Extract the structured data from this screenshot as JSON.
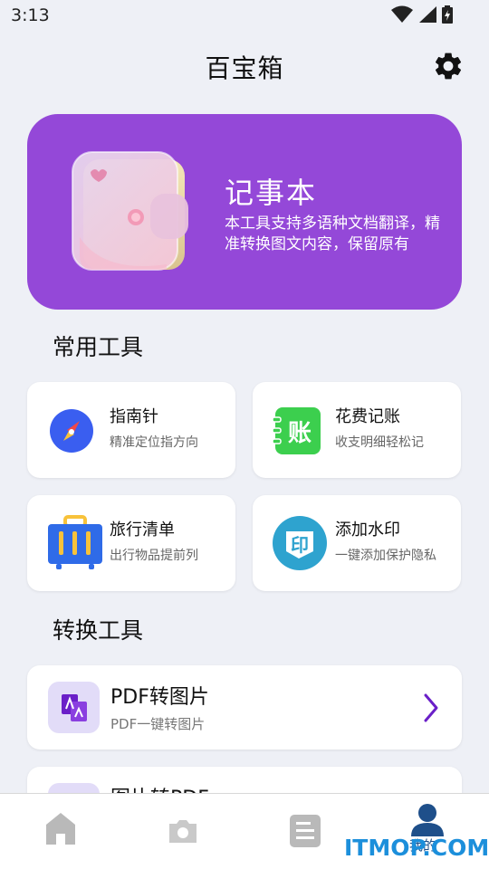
{
  "status_bar": {
    "time": "3:13",
    "icons": [
      "wifi-icon",
      "signal-icon",
      "battery-charging-icon"
    ]
  },
  "header": {
    "title": "百宝箱",
    "settings_icon": "gear-icon"
  },
  "banner": {
    "title": "记事本",
    "description": "本工具支持多语种文档翻译，精准转换图文内容，保留原有",
    "background": "#9448d8"
  },
  "common_tools": {
    "title": "常用工具",
    "items": [
      {
        "name": "指南针",
        "desc": "精准定位指方向",
        "icon": "compass-icon"
      },
      {
        "name": "花费记账",
        "desc": "收支明细轻松记",
        "icon": "ledger-icon"
      },
      {
        "name": "旅行清单",
        "desc": "出行物品提前列",
        "icon": "suitcase-icon"
      },
      {
        "name": "添加水印",
        "desc": "一键添加保护隐私",
        "icon": "watermark-icon"
      }
    ]
  },
  "convert_tools": {
    "title": "转换工具",
    "items": [
      {
        "name": "PDF转图片",
        "desc": "PDF一键转图片",
        "icon": "pdf-icon"
      },
      {
        "name": "图片转PDF",
        "desc": "",
        "icon": "image-to-pdf-icon"
      }
    ]
  },
  "bottom_nav": {
    "items": [
      {
        "icon": "home-icon"
      },
      {
        "icon": "camera-icon"
      },
      {
        "icon": "document-icon"
      },
      {
        "icon": "profile-icon",
        "label": "我的",
        "active": true
      }
    ],
    "active_color": "#1e4f8a"
  },
  "watermark_text": "ITMOP.COM",
  "colors": {
    "accent": "#9448d8",
    "background": "#eef0f6",
    "arrow": "#6a1fc8"
  }
}
